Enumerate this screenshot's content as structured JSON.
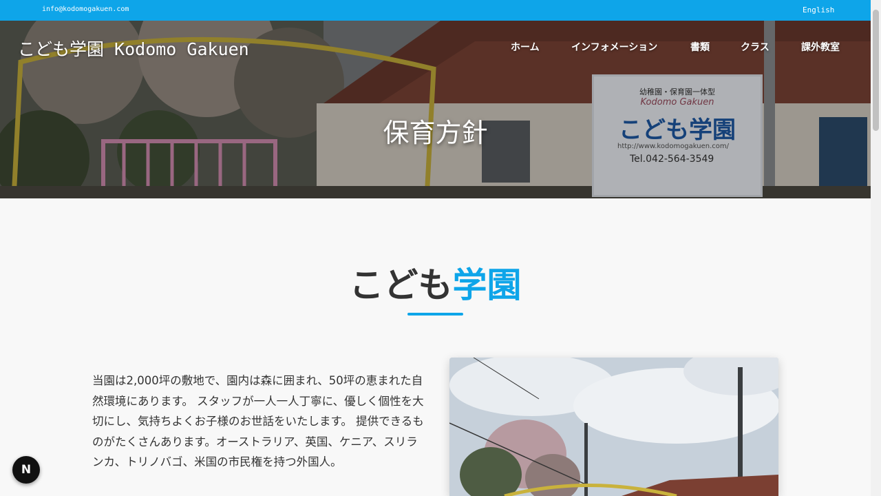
{
  "topbar": {
    "email": "info@kodomogakuen.com",
    "language_link": "English"
  },
  "header": {
    "brand": "こども学園 Kodomo Gakuen",
    "nav": [
      "ホーム",
      "インフォメーション",
      "書類",
      "クラス",
      "課外教室"
    ]
  },
  "hero": {
    "title": "保育方針",
    "sign": {
      "line1": "幼稚園・保育園一体型",
      "line2": "Kodomo Gakuen",
      "line3": "こども学園",
      "url": "http://www.kodomogakuen.com/",
      "tel": "Tel.042-564-3549"
    }
  },
  "section": {
    "title_part1": "こども",
    "title_part2": "学園",
    "paragraph": "当園は2,000坪の敷地で、園内は森に囲まれ、50坪の恵まれた自然環境にあります。 スタッフが一人一人丁寧に、優しく個性を大切にし、気持ちよくお子様のお世話をいたします。 提供できるものがたくさんあります。オーストラリア、英国、ケニア、スリランカ、トリノバゴ、米国の市民権を持つ外国人。"
  },
  "dev_button": {
    "label": "N"
  },
  "colors": {
    "accent": "#0ea5e9",
    "title_text": "#333333"
  }
}
